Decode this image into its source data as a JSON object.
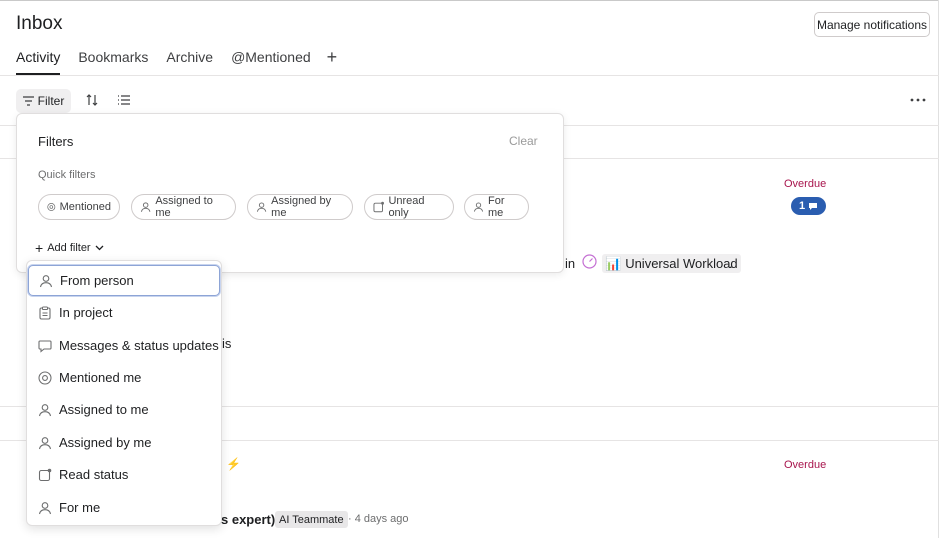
{
  "header": {
    "title": "Inbox",
    "manage_label": "Manage notifications"
  },
  "tabs": [
    {
      "label": "Activity",
      "active": true
    },
    {
      "label": "Bookmarks"
    },
    {
      "label": "Archive"
    },
    {
      "label": "@Mentioned"
    }
  ],
  "toolbar": {
    "filter_label": "Filter",
    "icons": [
      "filter-icon",
      "sort-icon",
      "list-view-icon",
      "more-options-icon"
    ]
  },
  "background": {
    "overdue_1": "Overdue",
    "comment_count": "1",
    "in_text": "in",
    "project_emoji": "📊",
    "project_name": "Universal Workload",
    "period": ".",
    "is_text": "is",
    "overdue_2": "Overdue",
    "emoji_fragment": "⚡",
    "expert_text": "s expert)",
    "ai_badge": "AI Teammate",
    "time_text": "· 4 days ago"
  },
  "filters": {
    "title": "Filters",
    "clear_label": "Clear",
    "quick_label": "Quick filters",
    "quick_filters": [
      {
        "label": "Mentioned",
        "icon": "at-icon"
      },
      {
        "label": "Assigned to me",
        "icon": "person-icon"
      },
      {
        "label": "Assigned by me",
        "icon": "person-icon"
      },
      {
        "label": "Unread only",
        "icon": "unread-icon"
      },
      {
        "label": "For me",
        "icon": "person-icon"
      }
    ],
    "add_filter_label": "Add filter"
  },
  "dropdown": {
    "items": [
      {
        "label": "From person",
        "icon": "person-icon"
      },
      {
        "label": "In project",
        "icon": "clipboard-icon"
      },
      {
        "label": "Messages & status updates",
        "icon": "speech-bubble-icon"
      },
      {
        "label": "Mentioned me",
        "icon": "at-icon"
      },
      {
        "label": "Assigned to me",
        "icon": "person-icon"
      },
      {
        "label": "Assigned by me",
        "icon": "person-icon"
      },
      {
        "label": "Read status",
        "icon": "unread-icon"
      },
      {
        "label": "For me",
        "icon": "person-icon"
      }
    ]
  }
}
